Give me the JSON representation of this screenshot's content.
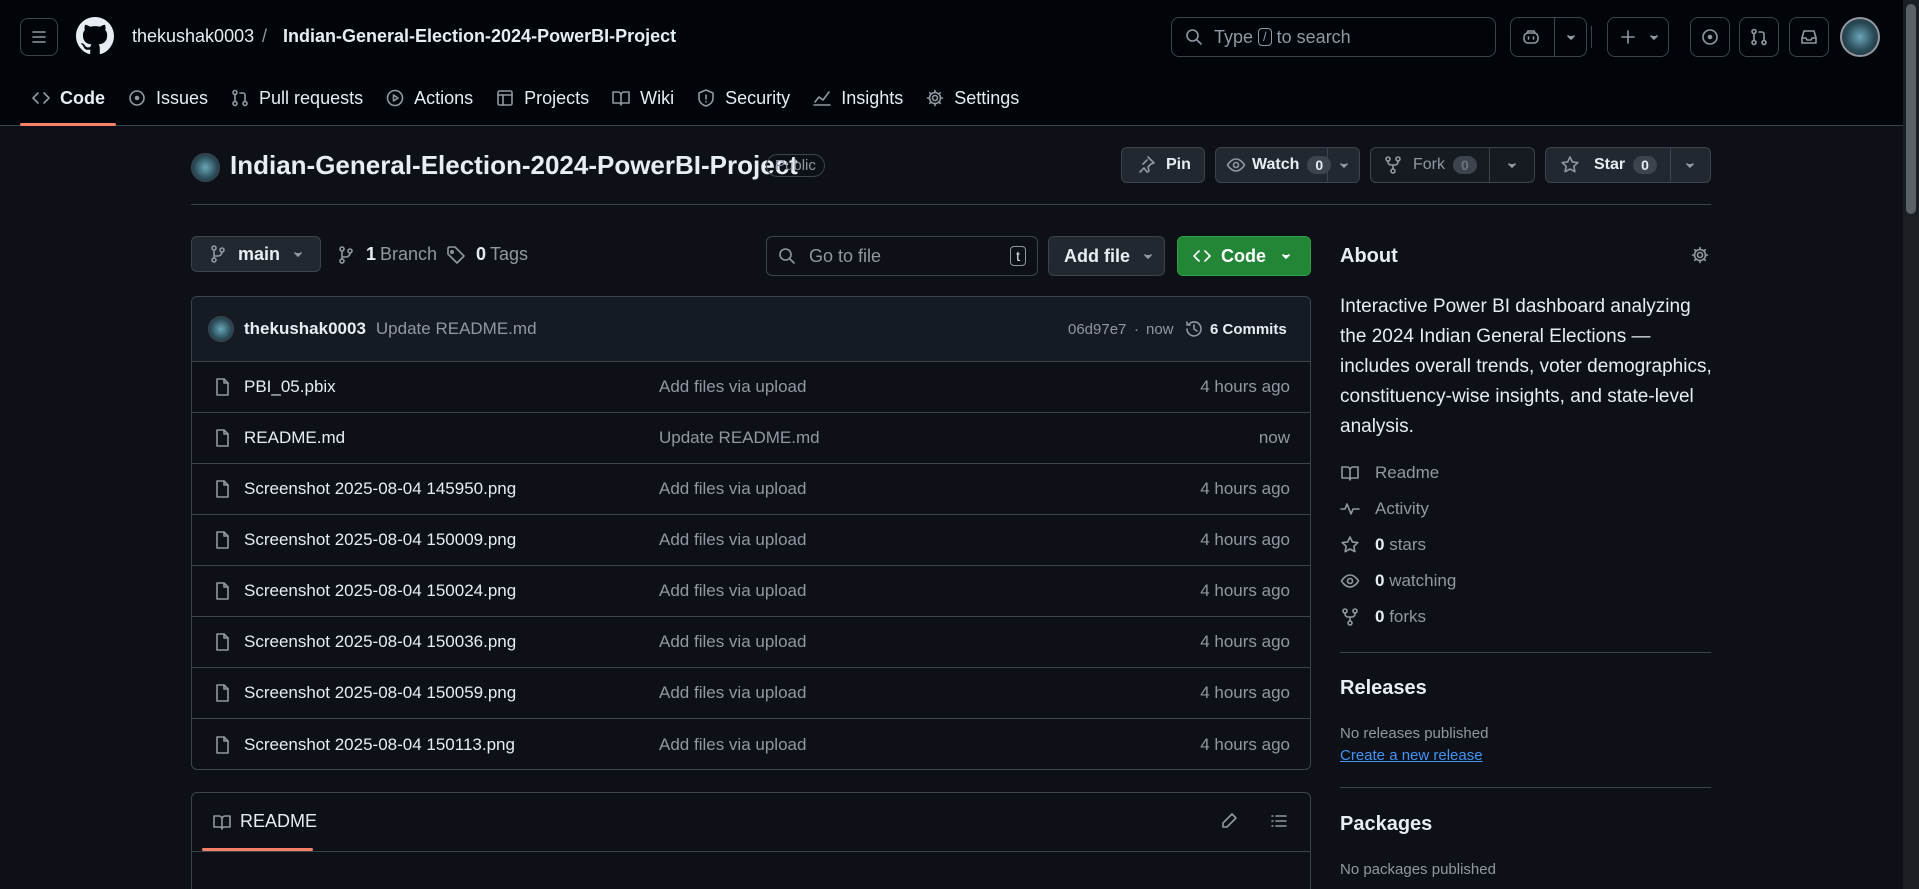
{
  "header": {
    "owner": "thekushak0003",
    "separator": "/",
    "repo": "Indian-General-Election-2024-PowerBI-Project",
    "search_pre": "Type",
    "search_key": "/",
    "search_post": "to search"
  },
  "tabs": [
    {
      "label": "Code",
      "icon": "code-icon"
    },
    {
      "label": "Issues",
      "icon": "issue-icon"
    },
    {
      "label": "Pull requests",
      "icon": "pull-request-icon"
    },
    {
      "label": "Actions",
      "icon": "play-icon"
    },
    {
      "label": "Projects",
      "icon": "table-icon"
    },
    {
      "label": "Wiki",
      "icon": "book-icon"
    },
    {
      "label": "Security",
      "icon": "shield-icon"
    },
    {
      "label": "Insights",
      "icon": "graph-icon"
    },
    {
      "label": "Settings",
      "icon": "gear-icon"
    }
  ],
  "repo_header": {
    "title": "Indian-General-Election-2024-PowerBI-Project",
    "visibility": "Public",
    "pin": "Pin",
    "watch": "Watch",
    "watch_count": "0",
    "fork": "Fork",
    "fork_count": "0",
    "star": "Star",
    "star_count": "0"
  },
  "toolbar": {
    "branch": "main",
    "branch_count": "1",
    "branch_label": "Branch",
    "tags_count": "0",
    "tags_label": "Tags",
    "goto_placeholder": "Go to file",
    "goto_key": "t",
    "add_file": "Add file",
    "code": "Code"
  },
  "commit": {
    "author": "thekushak0003",
    "message": "Update README.md",
    "hash": "06d97e7",
    "time": "now",
    "commits": "6 Commits"
  },
  "files": [
    {
      "name": "PBI_05.pbix",
      "message": "Add files via upload",
      "time": "4 hours ago"
    },
    {
      "name": "README.md",
      "message": "Update README.md",
      "time": "now"
    },
    {
      "name": "Screenshot 2025-08-04 145950.png",
      "message": "Add files via upload",
      "time": "4 hours ago"
    },
    {
      "name": "Screenshot 2025-08-04 150009.png",
      "message": "Add files via upload",
      "time": "4 hours ago"
    },
    {
      "name": "Screenshot 2025-08-04 150024.png",
      "message": "Add files via upload",
      "time": "4 hours ago"
    },
    {
      "name": "Screenshot 2025-08-04 150036.png",
      "message": "Add files via upload",
      "time": "4 hours ago"
    },
    {
      "name": "Screenshot 2025-08-04 150059.png",
      "message": "Add files via upload",
      "time": "4 hours ago"
    },
    {
      "name": "Screenshot 2025-08-04 150113.png",
      "message": "Add files via upload",
      "time": "4 hours ago"
    }
  ],
  "readme": {
    "label": "README"
  },
  "about": {
    "title": "About",
    "description": "Interactive Power BI dashboard analyzing the 2024 Indian General Elections — includes overall trends, voter demographics, constituency-wise insights, and state-level analysis.",
    "readme": "Readme",
    "activity": "Activity",
    "stars_count": "0",
    "stars_label": "stars",
    "watching_count": "0",
    "watching_label": "watching",
    "forks_count": "0",
    "forks_label": "forks"
  },
  "releases": {
    "title": "Releases",
    "none": "No releases published",
    "create": "Create a new release"
  },
  "packages": {
    "title": "Packages",
    "none": "No packages published"
  },
  "colors": {
    "accent_green": "#238636",
    "link_blue": "#4493f8",
    "tab_underline": "#f78166"
  }
}
